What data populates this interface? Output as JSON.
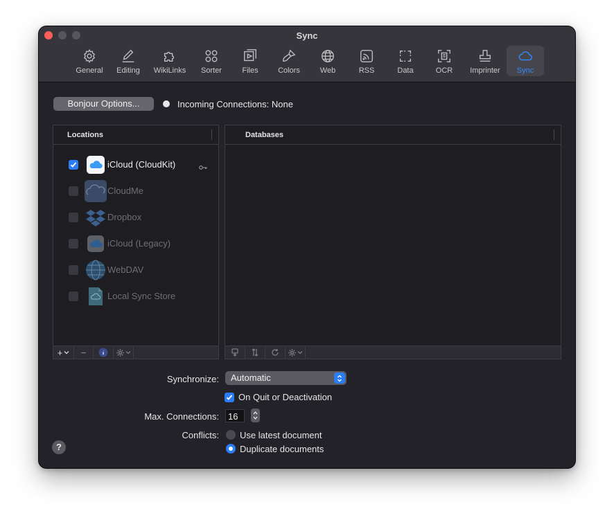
{
  "window": {
    "title": "Sync"
  },
  "toolbar": {
    "items": [
      {
        "label": "General",
        "icon": "gear-icon"
      },
      {
        "label": "Editing",
        "icon": "pencil-icon"
      },
      {
        "label": "WikiLinks",
        "icon": "puzzle-icon"
      },
      {
        "label": "Sorter",
        "icon": "circles-icon"
      },
      {
        "label": "Files",
        "icon": "files-icon"
      },
      {
        "label": "Colors",
        "icon": "brush-icon"
      },
      {
        "label": "Web",
        "icon": "globe-icon"
      },
      {
        "label": "RSS",
        "icon": "rss-icon"
      },
      {
        "label": "Data",
        "icon": "data-icon"
      },
      {
        "label": "OCR",
        "icon": "ocr-icon"
      },
      {
        "label": "Imprinter",
        "icon": "stamp-icon"
      },
      {
        "label": "Sync",
        "icon": "cloud-icon",
        "active": true
      }
    ]
  },
  "bonjour": {
    "button_label": "Bonjour Options...",
    "status": "Incoming Connections: None"
  },
  "locations": {
    "header": "Locations",
    "items": [
      {
        "label": "iCloud (CloudKit)",
        "checked": true,
        "enabled": true,
        "icon": "icloud-icon"
      },
      {
        "label": "CloudMe",
        "checked": false,
        "enabled": false,
        "icon": "cloudme-icon"
      },
      {
        "label": "Dropbox",
        "checked": false,
        "enabled": false,
        "icon": "dropbox-icon"
      },
      {
        "label": "iCloud (Legacy)",
        "checked": false,
        "enabled": false,
        "icon": "icloud-legacy-icon"
      },
      {
        "label": "WebDAV",
        "checked": false,
        "enabled": false,
        "icon": "webdav-globe-icon"
      },
      {
        "label": "Local Sync Store",
        "checked": false,
        "enabled": false,
        "icon": "local-store-icon"
      }
    ],
    "footer": {
      "add": "+",
      "remove": "−"
    }
  },
  "databases": {
    "header": "Databases"
  },
  "settings": {
    "synchronize_label": "Synchronize:",
    "synchronize_value": "Automatic",
    "quit_checkbox_label": "On Quit or Deactivation",
    "quit_checked": true,
    "max_connections_label": "Max. Connections:",
    "max_connections_value": "16",
    "conflicts_label": "Conflicts:",
    "conflict_options": [
      {
        "label": "Use latest document",
        "selected": false
      },
      {
        "label": "Duplicate documents",
        "selected": true
      }
    ]
  },
  "help": {
    "label": "?"
  },
  "colors": {
    "accent": "#2a7df5",
    "window_bg": "#232228",
    "titlebar_bg": "#36353b"
  }
}
